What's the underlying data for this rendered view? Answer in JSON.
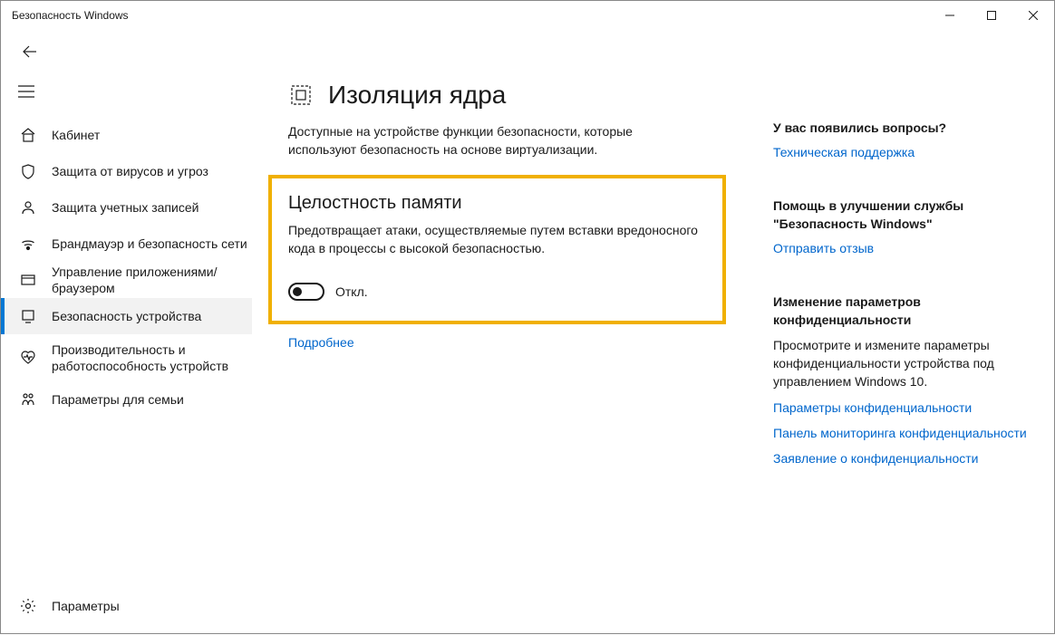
{
  "window": {
    "title": "Безопасность Windows"
  },
  "sidebar": {
    "items": [
      {
        "label": "Кабинет"
      },
      {
        "label": "Защита от вирусов и угроз"
      },
      {
        "label": "Защита учетных записей"
      },
      {
        "label": "Брандмауэр и безопасность сети"
      },
      {
        "label": "Управление приложениями/браузером"
      },
      {
        "label": "Безопасность устройства"
      },
      {
        "label": "Производительность и работоспособность устройств"
      },
      {
        "label": "Параметры для семьи"
      }
    ],
    "bottom": {
      "label": "Параметры"
    }
  },
  "main": {
    "title": "Изоляция ядра",
    "description": "Доступные на устройстве функции безопасности, которые используют безопасность на основе виртуализации.",
    "section": {
      "title": "Целостность памяти",
      "description": "Предотвращает атаки, осуществляемые путем вставки вредоносного кода в процессы с высокой безопасностью.",
      "toggle_state": "Откл."
    },
    "more_link": "Подробнее"
  },
  "right": {
    "questions": {
      "title": "У вас появились вопросы?",
      "link": "Техническая поддержка"
    },
    "improve": {
      "title": "Помощь в улучшении службы \"Безопасность Windows\"",
      "link": "Отправить отзыв"
    },
    "privacy": {
      "title": "Изменение параметров конфиденциальности",
      "description": "Просмотрите и измените параметры конфиденциальности устройства под управлением Windows 10.",
      "links": [
        "Параметры конфиденциальности",
        "Панель мониторинга конфиденциальности",
        "Заявление о конфиденциальности"
      ]
    }
  }
}
